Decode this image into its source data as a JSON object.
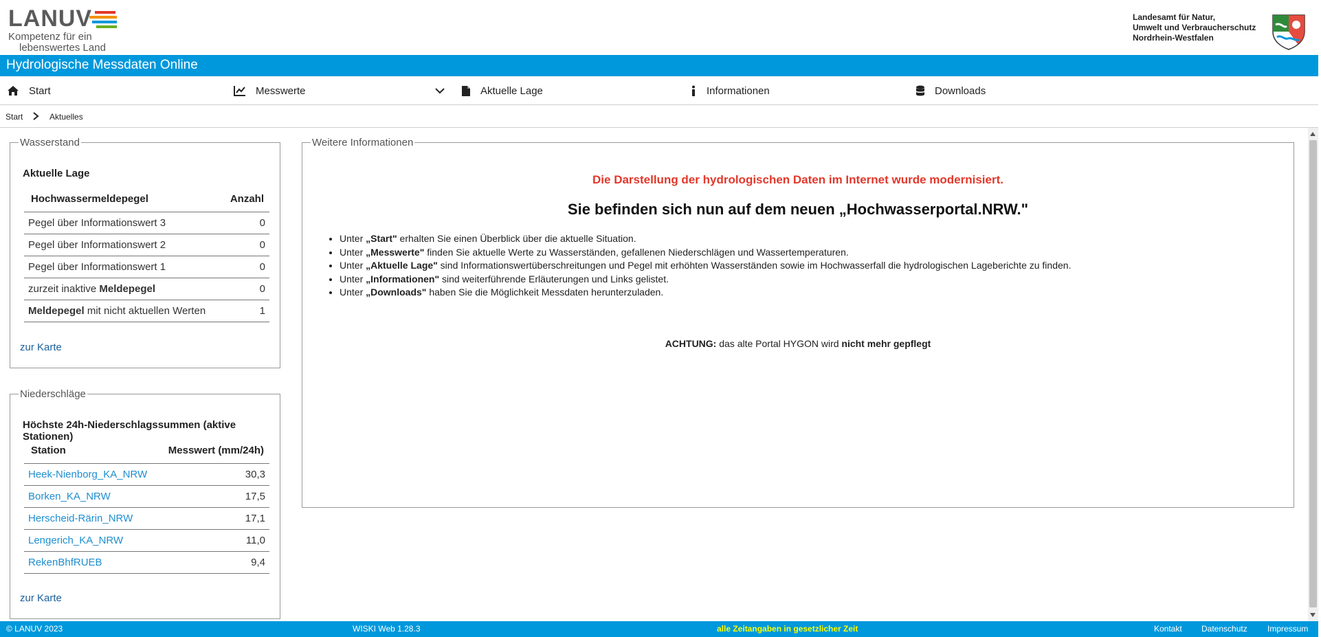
{
  "brand": {
    "logo_word": "LANUV",
    "tagline_line1": "Kompetenz für ein",
    "tagline_line2": "lebenswertes Land",
    "stripe_colors": [
      "#e2382b",
      "#f39200",
      "#ffcc00",
      "#0098dc",
      "#6ab023"
    ],
    "agency_line1": "Landesamt für Natur,",
    "agency_line2": "Umwelt und Verbraucherschutz",
    "agency_line3": "Nordrhein-Westfalen",
    "crest_icon": "nrw-coat-of-arms-icon"
  },
  "app_title": "Hydrologische Messdaten Online",
  "colors": {
    "accent": "#0098dc",
    "warning_red": "#e2382b",
    "footer_highlight": "#ffff00",
    "link": "#1f8fd0"
  },
  "nav": {
    "start": "Start",
    "messwerte": "Messwerte",
    "aktuelle_lage": "Aktuelle Lage",
    "informationen": "Informationen",
    "downloads": "Downloads"
  },
  "breadcrumb": {
    "start": "Start",
    "current": "Aktuelles"
  },
  "wasserstand": {
    "legend": "Wasserstand",
    "subtitle": "Aktuelle Lage",
    "col_name": "Hochwassermeldepegel",
    "col_count": "Anzahl",
    "rows": [
      {
        "pre": "Pegel über Informationswert 3",
        "bold": "",
        "post": "",
        "value": "0"
      },
      {
        "pre": "Pegel über Informationswert 2",
        "bold": "",
        "post": "",
        "value": "0"
      },
      {
        "pre": "Pegel über Informationswert 1",
        "bold": "",
        "post": "",
        "value": "0"
      },
      {
        "pre": "zurzeit inaktive ",
        "bold": "Meldepegel",
        "post": "",
        "value": "0"
      },
      {
        "pre": "",
        "bold": "Meldepegel",
        "post": " mit nicht aktuellen Werten",
        "value": "1"
      }
    ],
    "map_link": "zur Karte"
  },
  "niederschlaege": {
    "legend": "Niederschläge",
    "subtitle": "Höchste 24h-Niederschlagssummen (aktive Stationen)",
    "col_station": "Station",
    "col_value": "Messwert (mm/24h)",
    "rows": [
      {
        "station": "Heek-Nienborg_KA_NRW",
        "value": "30,3"
      },
      {
        "station": "Borken_KA_NRW",
        "value": "17,5"
      },
      {
        "station": "Herscheid-Rärin_NRW",
        "value": "17,1"
      },
      {
        "station": "Lengerich_KA_NRW",
        "value": "11,0"
      },
      {
        "station": "RekenBhfRUEB",
        "value": "9,4"
      }
    ],
    "map_link": "zur Karte"
  },
  "info": {
    "legend": "Weitere Informationen",
    "red_notice": "Die Darstellung der hydrologischen Daten im Internet wurde modernisiert.",
    "headline": "Sie befinden sich nun auf dem neuen „Hochwasserportal.NRW.\"",
    "items": [
      {
        "pre": "Unter ",
        "bold": "„Start\"",
        "post": " erhalten Sie einen Überblick über die aktuelle Situation."
      },
      {
        "pre": "Unter ",
        "bold": "„Messwerte\"",
        "post": " finden Sie aktuelle Werte zu Wasserständen, gefallenen Niederschlägen und Wassertemperaturen."
      },
      {
        "pre": "Unter ",
        "bold": "„Aktuelle Lage\"",
        "post": " sind Informationswertüberschreitungen und Pegel mit erhöhten Wasserständen sowie im Hochwasserfall die hydrologischen Lageberichte zu finden."
      },
      {
        "pre": "Unter ",
        "bold": "„Informationen\"",
        "post": " sind weiterführende Erläuterungen und Links gelistet."
      },
      {
        "pre": "Unter ",
        "bold": "„Downloads\"",
        "post": " haben Sie die Möglichkeit Messdaten herunterzuladen."
      }
    ],
    "warn_bold1": "ACHTUNG:",
    "warn_text": " das alte Portal HYGON wird ",
    "warn_bold2": "nicht mehr gepflegt"
  },
  "footer": {
    "copyright": "© LANUV 2023",
    "version": "WISKI Web 1.28.3",
    "time_note": "alle Zeitangaben in gesetzlicher Zeit",
    "kontakt": "Kontakt",
    "datenschutz": "Datenschutz",
    "impressum": "Impressum"
  }
}
